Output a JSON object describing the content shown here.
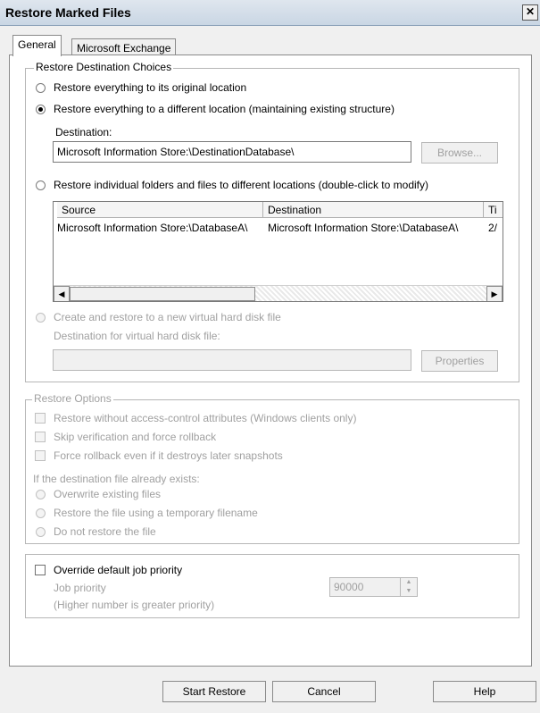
{
  "window": {
    "title": "Restore Marked Files",
    "close_glyph": "✕"
  },
  "tabs": [
    {
      "label": "General"
    },
    {
      "label": "Microsoft Exchange"
    }
  ],
  "destination_group": {
    "legend": "Restore Destination Choices",
    "opt_original": "Restore everything to its original location",
    "opt_different": "Restore everything to a different location (maintaining existing structure)",
    "destination_label": "Destination:",
    "destination_value": "Microsoft Information Store:\\DestinationDatabase\\",
    "browse_label": "Browse...",
    "opt_individual": "Restore individual folders and files to different locations (double-click to modify)",
    "table": {
      "columns": [
        "Source",
        "Destination",
        "Ti"
      ],
      "rows": [
        {
          "source": "Microsoft Information Store:\\DatabaseA\\",
          "destination": "Microsoft Information Store:\\DatabaseA\\",
          "time": "2/"
        }
      ]
    },
    "opt_vhd": "Create and restore to a new virtual hard disk file",
    "vhd_dest_label": "Destination for virtual hard disk file:",
    "vhd_dest_value": "",
    "properties_label": "Properties"
  },
  "restore_options": {
    "legend": "Restore Options",
    "chk_no_acl": "Restore without access-control attributes (Windows clients only)",
    "chk_skip_verify": "Skip verification and force rollback",
    "chk_force_rollback": "Force rollback even if it destroys later snapshots",
    "exists_label": "If the destination file already exists:",
    "opt_overwrite": "Overwrite existing files",
    "opt_temp": "Restore the file using a temporary filename",
    "opt_not_restore": "Do not restore the file"
  },
  "priority": {
    "override_label": "Override default job priority",
    "job_priority_label": "Job priority",
    "hint": "(Higher number is greater priority)",
    "value": "90000"
  },
  "buttons": {
    "start": "Start Restore",
    "cancel": "Cancel",
    "help": "Help"
  }
}
